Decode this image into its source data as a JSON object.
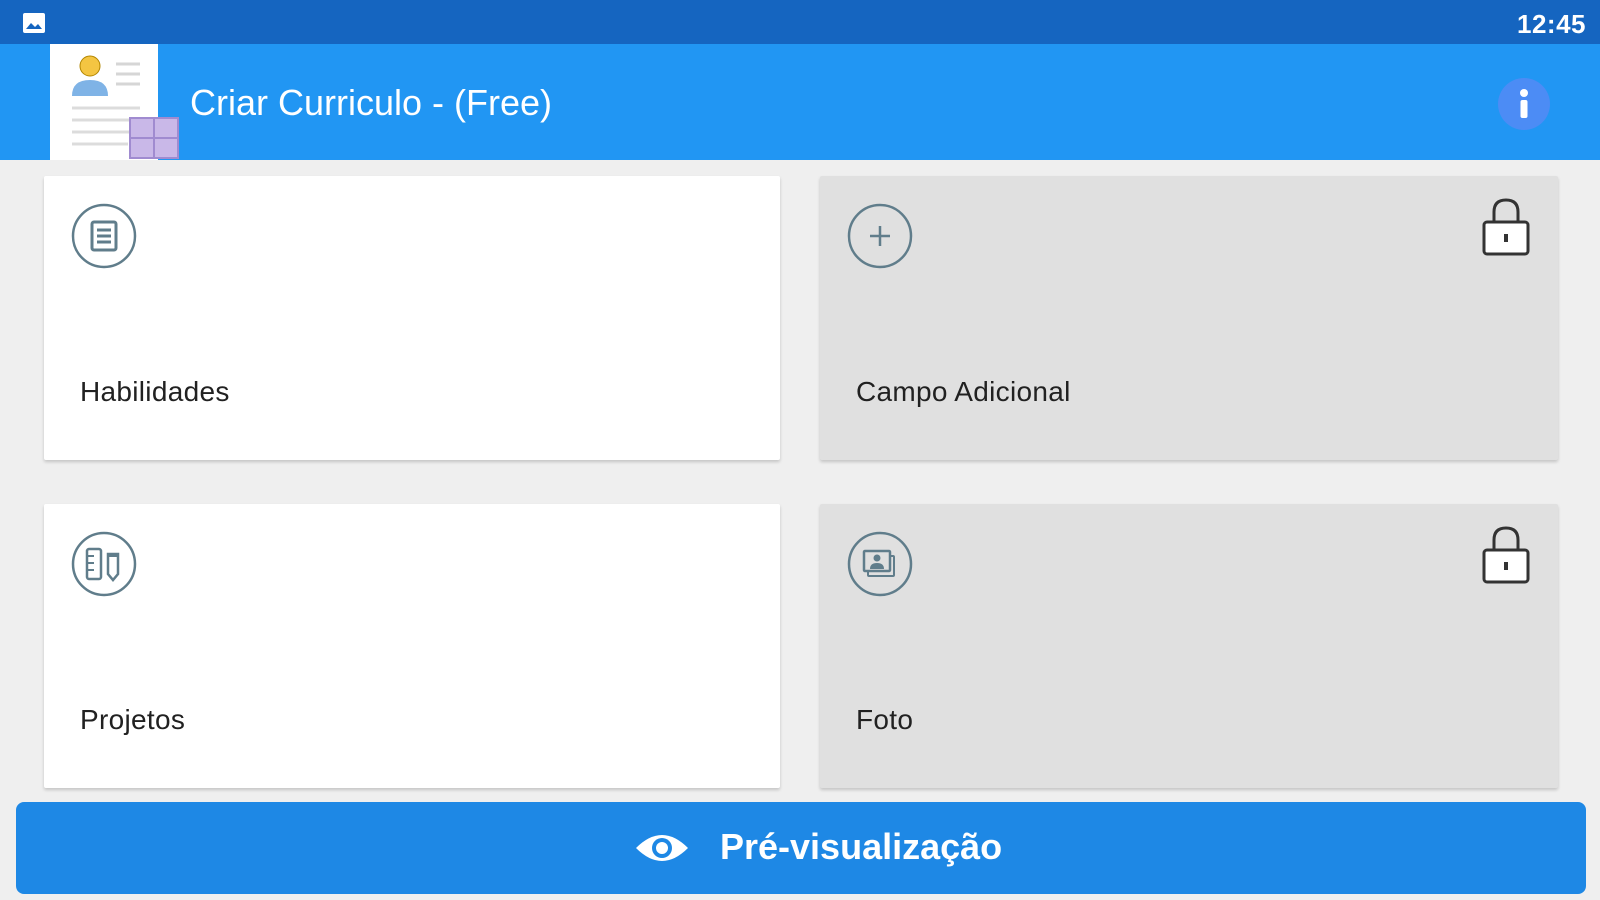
{
  "status_bar": {
    "time": "12:45",
    "notification_icon": "image-icon"
  },
  "app_bar": {
    "title": "Criar Curriculo - (Free)",
    "logo_icon": "resume-document-icon",
    "info_icon": "info-icon",
    "color": "#2196f3"
  },
  "cards": [
    {
      "label": "Habilidades",
      "icon": "list-icon",
      "locked": false
    },
    {
      "label": "Campo Adicional",
      "icon": "plus-icon",
      "locked": true
    },
    {
      "label": "Projetos",
      "icon": "tools-icon",
      "locked": false
    },
    {
      "label": "Foto",
      "icon": "photo-icon",
      "locked": true
    }
  ],
  "preview_button": {
    "label": "Pré-visualização",
    "icon": "eye-icon",
    "color": "#1e88e5"
  },
  "colors": {
    "status_bar": "#1565c0",
    "background": "#efefef",
    "locked_card": "#e0e0e0",
    "icon_stroke": "#607d8b"
  }
}
